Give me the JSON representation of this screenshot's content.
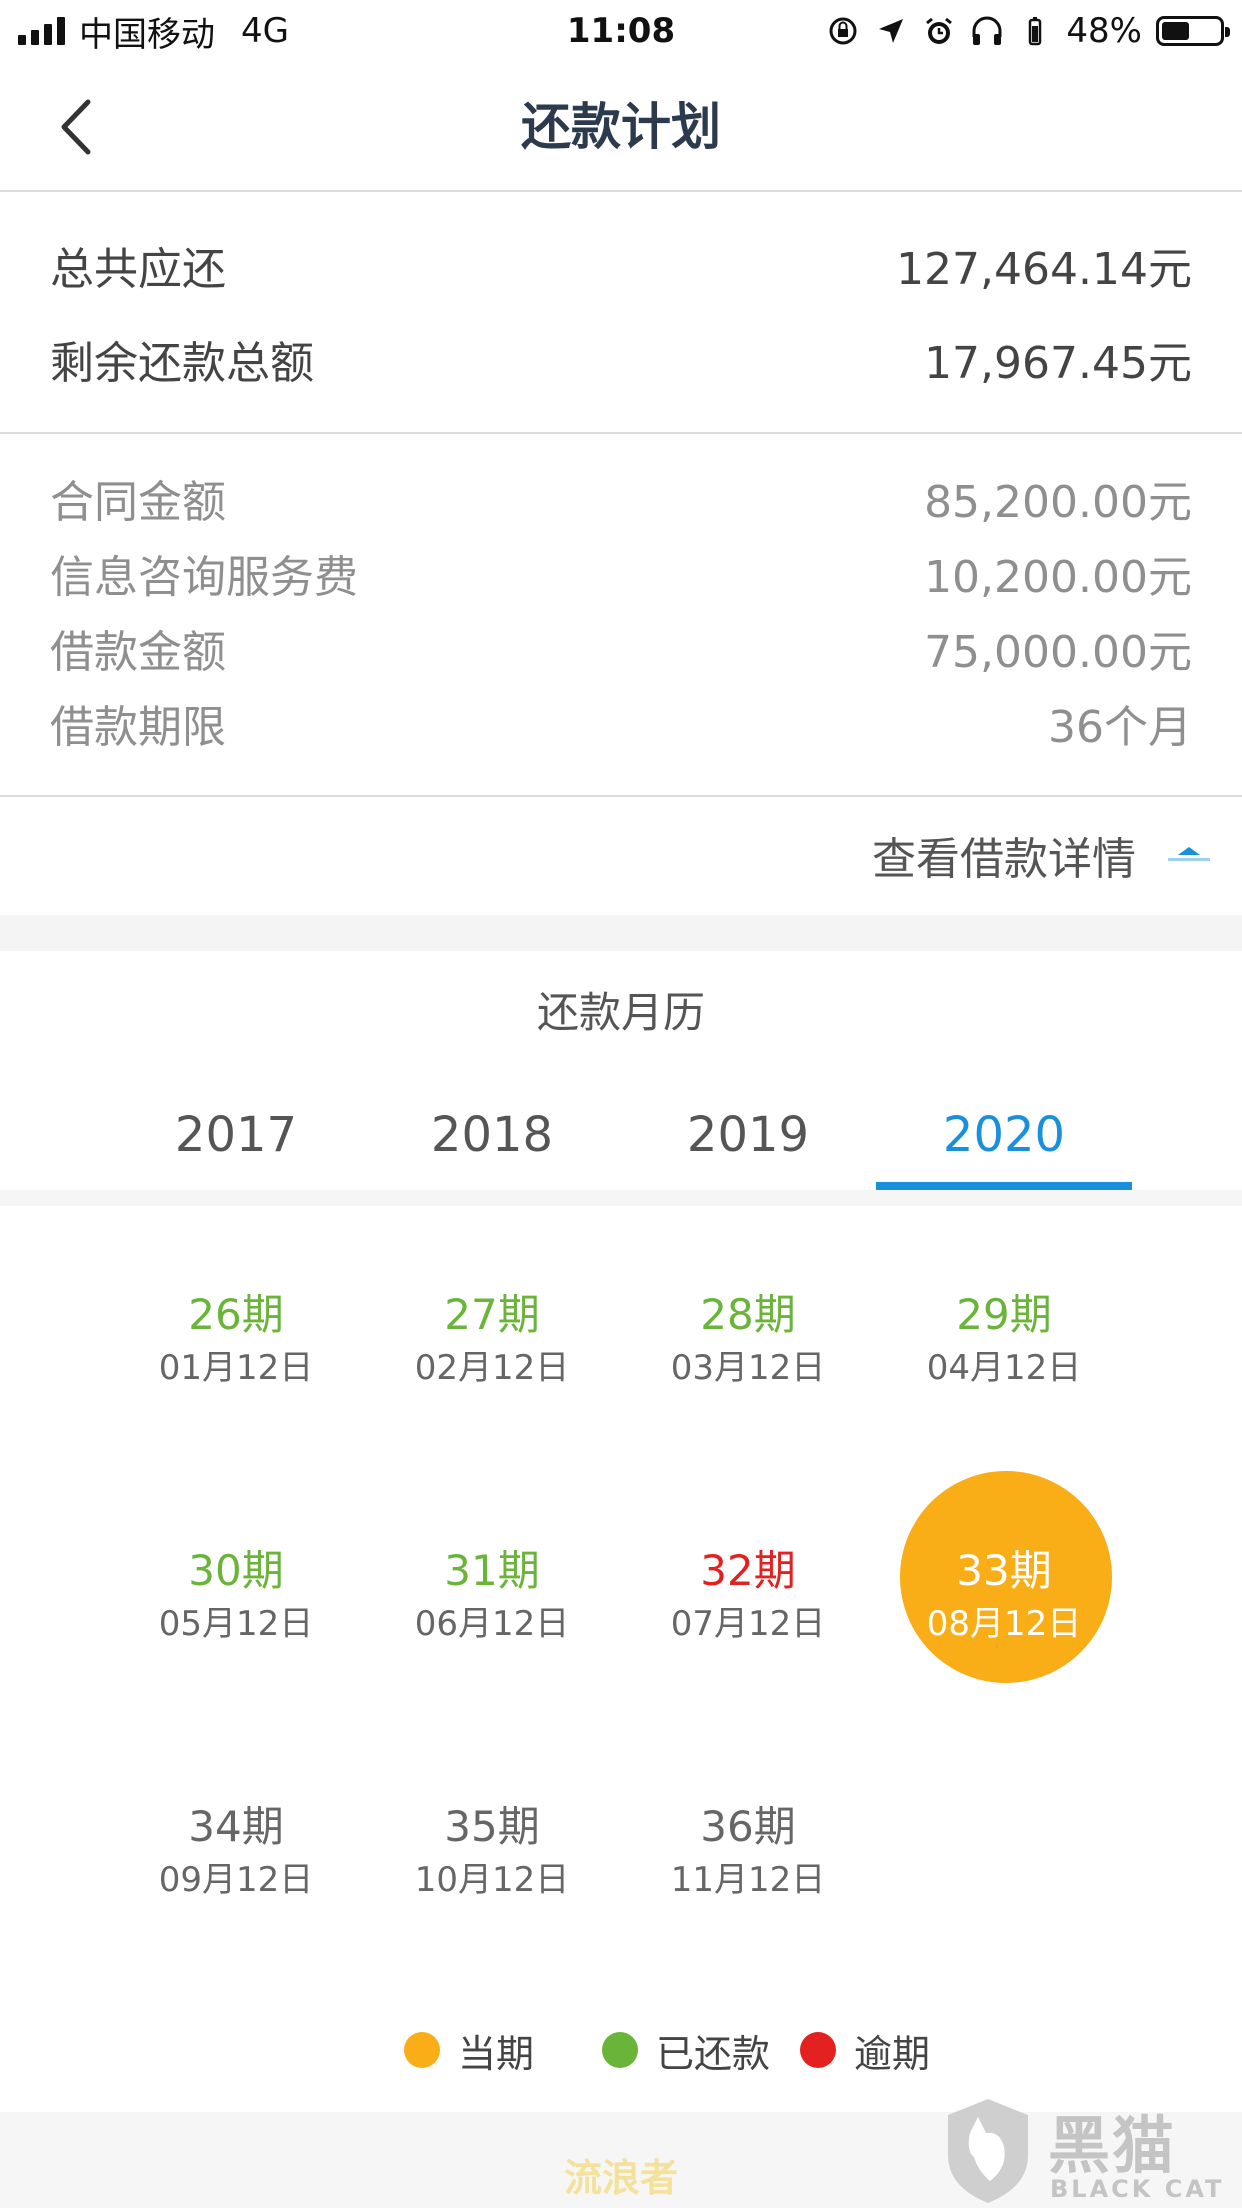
{
  "status_bar": {
    "carrier": "中国移动",
    "network": "4G",
    "time": "11:08",
    "battery": "48%",
    "battery_level": 0.48
  },
  "nav": {
    "title": "还款计划",
    "back_icon": "chevron-left-icon"
  },
  "summary": {
    "total_due_label": "总共应还",
    "total_due_value": "127,464.14元",
    "remaining_label": "剩余还款总额",
    "remaining_value": "17,967.45元"
  },
  "loan_info": {
    "contract_label": "合同金额",
    "contract_value": "85,200.00元",
    "fee_label": "信息咨询服务费",
    "fee_value": "10,200.00元",
    "principal_label": "借款金额",
    "principal_value": "75,000.00元",
    "term_label": "借款期限",
    "term_value": "36个月"
  },
  "detail_link": {
    "label": "查看借款详情",
    "icon": "chevron-up-icon"
  },
  "calendar": {
    "title": "还款月历",
    "years": [
      "2017",
      "2018",
      "2019",
      "2020"
    ],
    "active_year": "2020",
    "installments": [
      {
        "period": "26期",
        "date": "01月12日",
        "status": "paid"
      },
      {
        "period": "27期",
        "date": "02月12日",
        "status": "paid"
      },
      {
        "period": "28期",
        "date": "03月12日",
        "status": "paid"
      },
      {
        "period": "29期",
        "date": "04月12日",
        "status": "paid"
      },
      {
        "period": "30期",
        "date": "05月12日",
        "status": "paid"
      },
      {
        "period": "31期",
        "date": "06月12日",
        "status": "paid"
      },
      {
        "period": "32期",
        "date": "07月12日",
        "status": "overdue"
      },
      {
        "period": "33期",
        "date": "08月12日",
        "status": "current"
      },
      {
        "period": "34期",
        "date": "09月12日",
        "status": "future"
      },
      {
        "period": "35期",
        "date": "10月12日",
        "status": "future"
      },
      {
        "period": "36期",
        "date": "11月12日",
        "status": "future"
      }
    ]
  },
  "legend": {
    "current": "当期",
    "paid": "已还款",
    "overdue": "逾期"
  },
  "colors": {
    "accent_blue": "#1a8fdc",
    "current_orange": "#f9ad17",
    "paid_green": "#6ab43a",
    "overdue_red": "#e42121"
  },
  "footer": {
    "text": "流浪者"
  },
  "watermark": {
    "brand_cn": "黑猫",
    "brand_en": "BLACK CAT"
  }
}
